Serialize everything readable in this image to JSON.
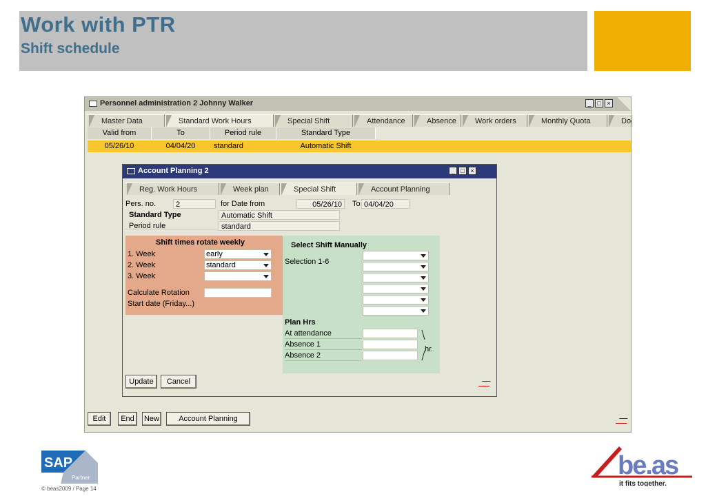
{
  "header": {
    "title": "Work with PTR",
    "subtitle": "Shift schedule",
    "accent_color": "#f0ae00",
    "title_color": "#3f6f8c"
  },
  "main_window": {
    "title": "Personnel administration 2 Johnny Walker",
    "tabs": [
      "Master Data",
      "Standard Work Hours",
      "Special Shift",
      "Attendance",
      "Absence",
      "Work orders",
      "Monthly Quota",
      "Docu"
    ],
    "active_tab": "Standard Work Hours",
    "table": {
      "columns": [
        "Valid from",
        "To",
        "Period rule",
        "Standard Type"
      ],
      "rows": [
        [
          "05/26/10",
          "04/04/20",
          "standard",
          "Automatic Shift"
        ]
      ]
    },
    "buttons": {
      "edit": "Edit",
      "end": "End",
      "new": "New",
      "account_planning": "Account Planning"
    }
  },
  "dialog": {
    "title": "Account Planning 2",
    "tabs": [
      "Reg. Work Hours",
      "Week plan",
      "Special Shift",
      "Account Planning"
    ],
    "active_tab": "Special Shift",
    "pers_no_label": "Pers. no.",
    "pers_no": "2",
    "date_from_label": "for Date from",
    "date_from": "05/26/10",
    "to_label": "To",
    "to": "04/04/20",
    "standard_type_label": "Standard Type",
    "standard_type": "Automatic Shift",
    "period_rule_label": "Period rule",
    "period_rule": "standard",
    "shift_panel": {
      "title": "Shift times rotate weekly",
      "weeks": [
        {
          "label": "1. Week",
          "value": "early"
        },
        {
          "label": "2. Week",
          "value": "standard"
        },
        {
          "label": "3. Week",
          "value": ""
        }
      ],
      "calculate_rotation": "Calculate Rotation",
      "start_date": "Start date (Friday...)"
    },
    "manual_panel": {
      "title": "Select Shift Manually",
      "selection_label": "Selection 1-6",
      "plan_hrs_title": "Plan Hrs",
      "at_attendance": "At attendance",
      "absence1": "Absence 1",
      "absence2": "Absence 2",
      "unit": "hr."
    },
    "buttons": {
      "update": "Update",
      "cancel": "Cancel"
    }
  },
  "footer": {
    "sap_text": "SAP",
    "partner_text": "Partner",
    "copyright": "© beas2009 / Page  14",
    "beas_logo": "be.as",
    "beas_tagline": "it fits together."
  }
}
